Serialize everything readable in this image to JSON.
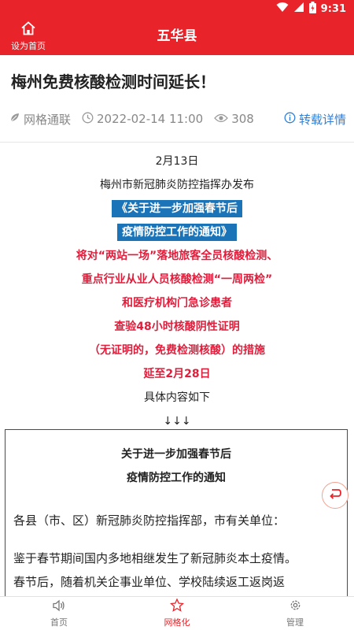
{
  "status_bar": {
    "time": "9:31",
    "icons": [
      "wifi-icon",
      "signal-icon",
      "battery-icon"
    ]
  },
  "app_bar": {
    "home_label": "设为首页",
    "title": "五华县",
    "home_icon": "home-icon"
  },
  "article": {
    "title": "梅州免费核酸检测时间延长！",
    "source": "网格通联",
    "datetime": "2022-02-14 11:00",
    "views": "308",
    "detail_link": "转载详情"
  },
  "poster": {
    "date": "2月13日",
    "issuer": "梅州市新冠肺炎防控指挥办发布",
    "highlight_1": "《关于进一步加强春节后",
    "highlight_2": "疫情防控工作的通知》",
    "red_1": "将对“两站一场”落地旅客全员核酸检测、",
    "red_2": "重点行业从业人员核酸检测“一周两检”",
    "red_3": "和医疗机构门急诊患者",
    "red_4": "查验48小时核酸阴性证明",
    "red_5": "（无证明的，免费检测核酸）的措施",
    "red_6": "延至2月28日",
    "details": "具体内容如下",
    "arrows": "↓↓↓"
  },
  "notice": {
    "title_1": "关于进一步加强春节后",
    "title_2": "疫情防控工作的通知",
    "salutation": "各县（市、区）新冠肺炎防控指挥部，市有关单位：",
    "body_1": "鉴于春节期间国内多地相继发生了新冠肺炎本土疫情。",
    "body_2": "春节后，随着机关企事业单位、学校陆续返工返岗返"
  },
  "tabs": [
    {
      "label": "首页",
      "icon": "speaker-icon",
      "active": false
    },
    {
      "label": "网格化",
      "icon": "star-icon",
      "active": true
    },
    {
      "label": "管理",
      "icon": "gear-icon",
      "active": false
    }
  ],
  "colors": {
    "brand_red": "#e8242a",
    "poster_red": "#e01e3c",
    "highlight_blue": "#1b74b8",
    "link_blue": "#2f7fd8"
  }
}
